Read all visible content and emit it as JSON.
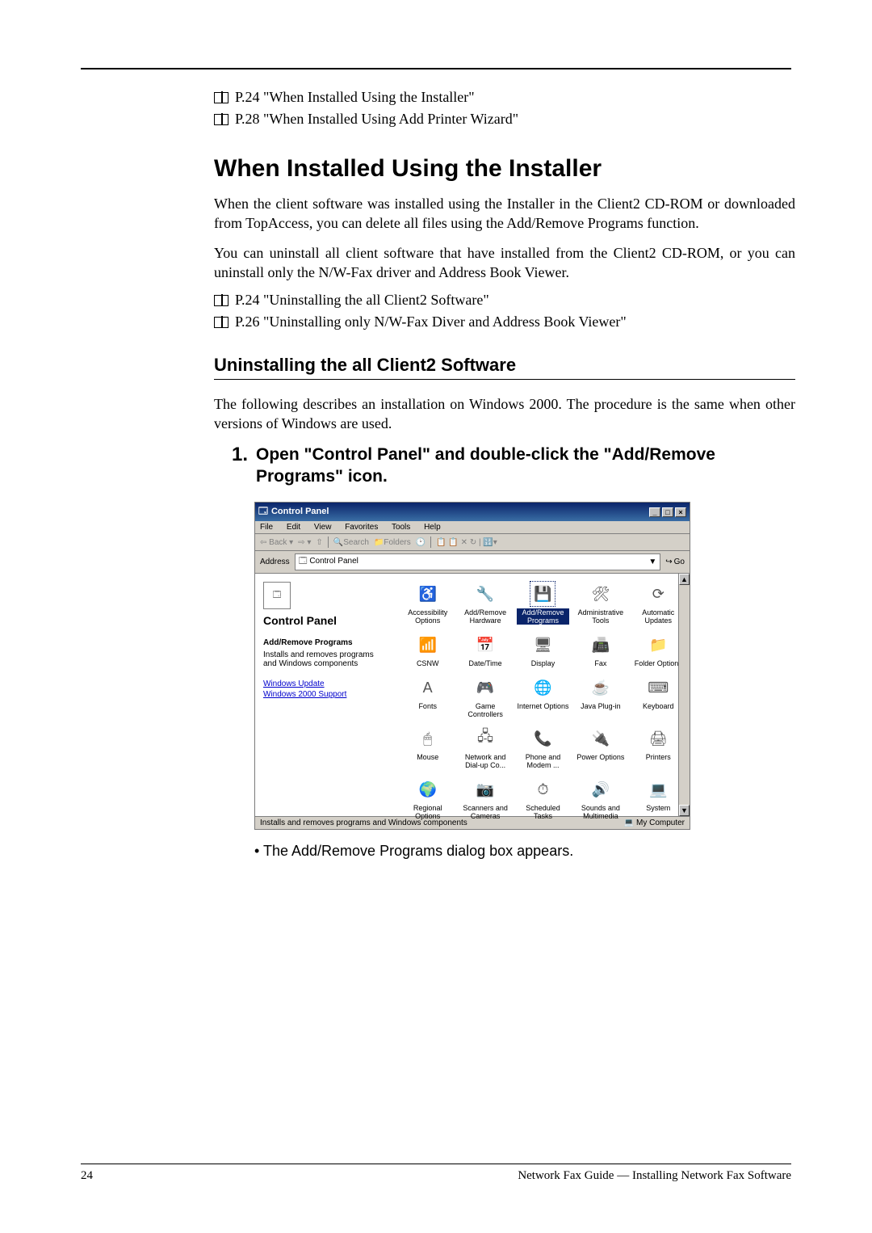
{
  "refs": {
    "r1": "P.24 \"When Installed Using the Installer\"",
    "r2": "P.28 \"When Installed Using Add Printer Wizard\"",
    "r3": "P.24 \"Uninstalling the all Client2 Software\"",
    "r4": "P.26 \"Uninstalling only N/W-Fax Diver and Address Book Viewer\""
  },
  "section_title": "When Installed Using the Installer",
  "para1": "When the client software was installed using the Installer in the Client2 CD-ROM or downloaded from TopAccess, you can delete all files using the Add/Remove Programs function.",
  "para2": "You can uninstall all client software that have installed from the Client2 CD-ROM, or you can uninstall only the N/W-Fax driver and Address Book Viewer.",
  "subsection_title": "Uninstalling the all Client2 Software",
  "para3": "The following describes an installation on Windows 2000.  The procedure is the same when other versions of Windows are used.",
  "step_num": "1.",
  "step_text": "Open \"Control Panel\" and double-click the \"Add/Remove Programs\" icon.",
  "bullet": "The Add/Remove Programs dialog box appears.",
  "screenshot": {
    "title": "Control Panel",
    "menu": [
      "File",
      "Edit",
      "View",
      "Favorites",
      "Tools",
      "Help"
    ],
    "toolbar": {
      "back": "Back",
      "search": "Search",
      "folders": "Folders"
    },
    "address_label": "Address",
    "address_value": "Control Panel",
    "go": "Go",
    "left": {
      "heading": "Control Panel",
      "bold": "Add/Remove Programs",
      "desc": "Installs and removes programs and Windows components",
      "link1": "Windows Update",
      "link2": "Windows 2000 Support"
    },
    "items": [
      {
        "icon": "♿",
        "label": "Accessibility Options"
      },
      {
        "icon": "🔧",
        "label": "Add/Remove Hardware"
      },
      {
        "icon": "💾",
        "label": "Add/Remove Programs",
        "selected": true
      },
      {
        "icon": "🛠",
        "label": "Administrative Tools"
      },
      {
        "icon": "⟳",
        "label": "Automatic Updates"
      },
      {
        "icon": "📶",
        "label": "CSNW"
      },
      {
        "icon": "📅",
        "label": "Date/Time"
      },
      {
        "icon": "🖥",
        "label": "Display"
      },
      {
        "icon": "📠",
        "label": "Fax"
      },
      {
        "icon": "📁",
        "label": "Folder Options"
      },
      {
        "icon": "A",
        "label": "Fonts"
      },
      {
        "icon": "🎮",
        "label": "Game Controllers"
      },
      {
        "icon": "🌐",
        "label": "Internet Options"
      },
      {
        "icon": "☕",
        "label": "Java Plug-in"
      },
      {
        "icon": "⌨",
        "label": "Keyboard"
      },
      {
        "icon": "🖱",
        "label": "Mouse"
      },
      {
        "icon": "🖧",
        "label": "Network and Dial-up Co..."
      },
      {
        "icon": "📞",
        "label": "Phone and Modem ..."
      },
      {
        "icon": "🔌",
        "label": "Power Options"
      },
      {
        "icon": "🖨",
        "label": "Printers"
      },
      {
        "icon": "🌍",
        "label": "Regional Options"
      },
      {
        "icon": "📷",
        "label": "Scanners and Cameras"
      },
      {
        "icon": "⏱",
        "label": "Scheduled Tasks"
      },
      {
        "icon": "🔊",
        "label": "Sounds and Multimedia"
      },
      {
        "icon": "💻",
        "label": "System"
      }
    ],
    "status_left": "Installs and removes programs and Windows components",
    "status_right": "My Computer"
  },
  "footer": {
    "page": "24",
    "label": "Network Fax Guide — Installing Network Fax Software"
  }
}
